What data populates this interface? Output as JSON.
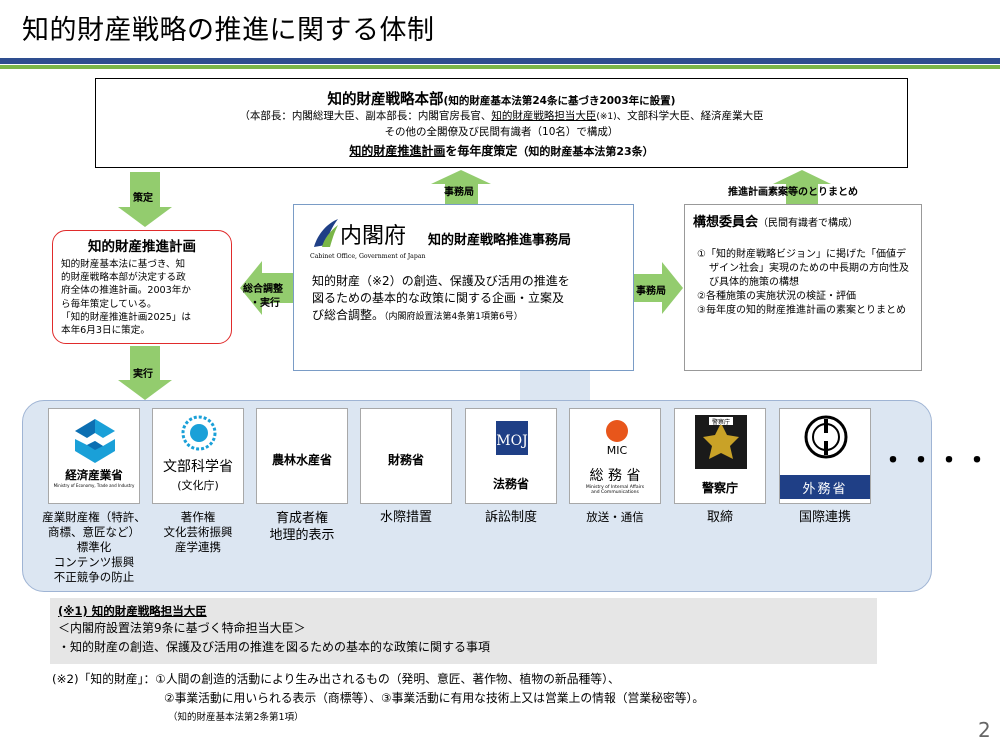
{
  "title": "知的財産戦略の推進に関する体制",
  "headquarters": {
    "name": "知的財産戦略本部",
    "basis": "(知的財産基本法第24条に基づき2003年に設置)",
    "members_line1_pre": "（本部長：内閣総理大臣、副本部長：内閣官房長官、",
    "members_line1_minister": "知的財産戦略担当大臣",
    "members_line1_mark": "(※1)",
    "members_line1_post": "、文部科学大臣、経済産業大臣",
    "members_line2": "その他の全閣僚及び民間有識者（10名）で構成）",
    "plan_line_pre": "知的財産推進計画",
    "plan_line_post": "を毎年度策定",
    "plan_line_basis": "（知的財産基本法第23条）"
  },
  "arrows": {
    "policy": "策定",
    "secretariat_up": "事務局",
    "summary": "推進計画素案等のとりまとめ",
    "coordination_1": "総合調整",
    "coordination_2": "・実行",
    "secretariat_right": "事務局",
    "execute": "実行"
  },
  "plan_box": {
    "title": "知的財産推進計画",
    "lines": [
      "知的財産基本法に基づき、知",
      "的財産戦略本部が決定する政",
      "府全体の推進計画。2003年か",
      "ら毎年策定している。",
      "「知的財産推進計画2025」は",
      "本年6月3日に策定。"
    ]
  },
  "secretariat": {
    "logo_text": "内閣府",
    "logo_sub": "Cabinet Office, Government of Japan",
    "name": "知的財産戦略推進事務局",
    "desc_lines": [
      "知的財産（※2）の創造、保護及び活用の推進を",
      "図るための基本的な政策に関する企画・立案及",
      "び総合調整。"
    ],
    "desc_basis": "（内閣府設置法第4条第1項第6号）"
  },
  "committee": {
    "name": "構想委員会",
    "composition": "（民間有識者で構成）",
    "items": [
      "①「知的財産戦略ビジョン」に掲げた「価値デザイン社会」実現のための中長期の方向性及び具体的施策の構想",
      "②各種施策の実施状況の検証・評価",
      "③毎年度の知的財産推進計画の素案とりまとめ"
    ]
  },
  "ministries": [
    {
      "name": "経済産業省",
      "name_en": "Ministry of Economy, Trade and Industry",
      "desc": [
        "産業財産権（特許、",
        "商標、意匠など）",
        "標準化",
        "コンテンツ振興",
        "不正競争の防止"
      ]
    },
    {
      "name": "文部科学省",
      "sub": "(文化庁)",
      "desc": [
        "著作権",
        "文化芸術振興",
        "産学連携"
      ]
    },
    {
      "name": "農林水産省",
      "desc": [
        "育成者権",
        "地理的表示"
      ]
    },
    {
      "name": "財務省",
      "desc": [
        "水際措置"
      ]
    },
    {
      "name": "法務省",
      "logo": "MOJ",
      "desc": [
        "訴訟制度"
      ]
    },
    {
      "name": "総 務 省",
      "logo": "MIC",
      "name_en": "Ministry of Internal Affairs and Communications",
      "desc": [
        "放送・通信"
      ]
    },
    {
      "name": "警察庁",
      "emblem": "警察庁",
      "desc": [
        "取締"
      ]
    },
    {
      "name": "外務省",
      "desc": [
        "国際連携"
      ]
    }
  ],
  "more": "・・・・",
  "note1": {
    "title": "(※1) 知的財産戦略担当大臣",
    "line1": "＜内閣府設置法第9条に基づく特命担当大臣＞",
    "line2": "・知的財産の創造、保護及び活用の推進を図るための基本的な政策に関する事項"
  },
  "note2": {
    "line1": "(※2)「知的財産」：①人間の創造的活動により生み出されるもの（発明、意匠、著作物、植物の新品種等）、",
    "line2": "②事業活動に用いられる表示（商標等）、③事業活動に有用な技術上又は営業上の情報（営業秘密等）。",
    "line3": "（知的財産基本法第2条第1項）"
  },
  "page_number": "2",
  "colors": {
    "arrow": "#93cc6e",
    "plan_border": "#e02b2b",
    "panel": "#dce6f2",
    "rule_blue": "#2e4d8f",
    "rule_green": "#7ab648"
  }
}
